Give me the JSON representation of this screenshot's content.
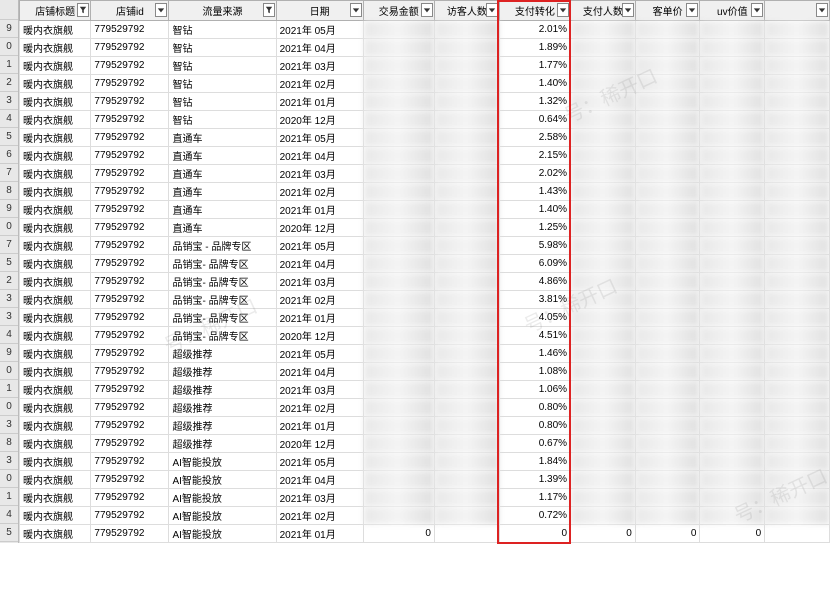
{
  "columns": [
    {
      "key": "shop",
      "label": "店铺标题",
      "filtered": true
    },
    {
      "key": "id",
      "label": "店铺id",
      "filtered": false
    },
    {
      "key": "src",
      "label": "流量来源",
      "filtered": true
    },
    {
      "key": "date",
      "label": "日期",
      "filtered": false
    },
    {
      "key": "amt",
      "label": "交易金额",
      "filtered": false
    },
    {
      "key": "vis",
      "label": "访客人数",
      "filtered": false
    },
    {
      "key": "conv",
      "label": "支付转化",
      "filtered": false
    },
    {
      "key": "pay",
      "label": "支付人数",
      "filtered": false
    },
    {
      "key": "unit",
      "label": "客单价",
      "filtered": false
    },
    {
      "key": "uv",
      "label": "uv价值",
      "filtered": false
    },
    {
      "key": "extra",
      "label": "",
      "filtered": false
    }
  ],
  "rowNumbers": [
    "",
    "9",
    "0",
    "1",
    "2",
    "3",
    "4",
    "5",
    "6",
    "7",
    "8",
    "9",
    "0",
    "7",
    "5",
    "2",
    "3",
    "3",
    "4",
    "9",
    "0",
    "1",
    "0",
    "3",
    "8",
    "3",
    "0",
    "1",
    "4",
    "5"
  ],
  "rows": [
    {
      "shop": "暖内衣旗舰",
      "id": "779529792",
      "src": "智钻",
      "date": "2021年 05月",
      "conv": "2.01%"
    },
    {
      "shop": "暖内衣旗舰",
      "id": "779529792",
      "src": "智钻",
      "date": "2021年 04月",
      "conv": "1.89%"
    },
    {
      "shop": "暖内衣旗舰",
      "id": "779529792",
      "src": "智钻",
      "date": "2021年 03月",
      "conv": "1.77%"
    },
    {
      "shop": "暖内衣旗舰",
      "id": "779529792",
      "src": "智钻",
      "date": "2021年 02月",
      "conv": "1.40%"
    },
    {
      "shop": "暖内衣旗舰",
      "id": "779529792",
      "src": "智钻",
      "date": "2021年 01月",
      "conv": "1.32%"
    },
    {
      "shop": "暖内衣旗舰",
      "id": "779529792",
      "src": "智钻",
      "date": "2020年 12月",
      "conv": "0.64%"
    },
    {
      "shop": "暖内衣旗舰",
      "id": "779529792",
      "src": "直通车",
      "date": "2021年 05月",
      "conv": "2.58%"
    },
    {
      "shop": "暖内衣旗舰",
      "id": "779529792",
      "src": "直通车",
      "date": "2021年 04月",
      "conv": "2.15%"
    },
    {
      "shop": "暖内衣旗舰",
      "id": "779529792",
      "src": "直通车",
      "date": "2021年 03月",
      "conv": "2.02%"
    },
    {
      "shop": "暖内衣旗舰",
      "id": "779529792",
      "src": "直通车",
      "date": "2021年 02月",
      "conv": "1.43%"
    },
    {
      "shop": "暖内衣旗舰",
      "id": "779529792",
      "src": "直通车",
      "date": "2021年 01月",
      "conv": "1.40%"
    },
    {
      "shop": "暖内衣旗舰",
      "id": "779529792",
      "src": "直通车",
      "date": "2020年 12月",
      "conv": "1.25%"
    },
    {
      "shop": "暖内衣旗舰",
      "id": "779529792",
      "src": "品销宝 - 品牌专区",
      "date": "2021年 05月",
      "conv": "5.98%"
    },
    {
      "shop": "暖内衣旗舰",
      "id": "779529792",
      "src": "品销宝- 品牌专区",
      "date": "2021年 04月",
      "conv": "6.09%"
    },
    {
      "shop": "暖内衣旗舰",
      "id": "779529792",
      "src": "品销宝- 品牌专区",
      "date": "2021年 03月",
      "conv": "4.86%"
    },
    {
      "shop": "暖内衣旗舰",
      "id": "779529792",
      "src": "品销宝- 品牌专区",
      "date": "2021年 02月",
      "conv": "3.81%"
    },
    {
      "shop": "暖内衣旗舰",
      "id": "779529792",
      "src": "品销宝- 品牌专区",
      "date": "2021年 01月",
      "conv": "4.05%"
    },
    {
      "shop": "暖内衣旗舰",
      "id": "779529792",
      "src": "品销宝- 品牌专区",
      "date": "2020年 12月",
      "conv": "4.51%"
    },
    {
      "shop": "暖内衣旗舰",
      "id": "779529792",
      "src": "超级推荐",
      "date": "2021年 05月",
      "conv": "1.46%"
    },
    {
      "shop": "暖内衣旗舰",
      "id": "779529792",
      "src": "超级推荐",
      "date": "2021年 04月",
      "conv": "1.08%"
    },
    {
      "shop": "暖内衣旗舰",
      "id": "779529792",
      "src": "超级推荐",
      "date": "2021年 03月",
      "conv": "1.06%"
    },
    {
      "shop": "暖内衣旗舰",
      "id": "779529792",
      "src": "超级推荐",
      "date": "2021年 02月",
      "conv": "0.80%"
    },
    {
      "shop": "暖内衣旗舰",
      "id": "779529792",
      "src": "超级推荐",
      "date": "2021年 01月",
      "conv": "0.80%"
    },
    {
      "shop": "暖内衣旗舰",
      "id": "779529792",
      "src": "超级推荐",
      "date": "2020年 12月",
      "conv": "0.67%"
    },
    {
      "shop": "暖内衣旗舰",
      "id": "779529792",
      "src": "AI智能投放",
      "date": "2021年 05月",
      "conv": "1.84%"
    },
    {
      "shop": "暖内衣旗舰",
      "id": "779529792",
      "src": "AI智能投放",
      "date": "2021年 04月",
      "conv": "1.39%"
    },
    {
      "shop": "暖内衣旗舰",
      "id": "779529792",
      "src": "AI智能投放",
      "date": "2021年 03月",
      "conv": "1.17%"
    },
    {
      "shop": "暖内衣旗舰",
      "id": "779529792",
      "src": "AI智能投放",
      "date": "2021年 02月",
      "conv": "0.72%"
    },
    {
      "shop": "暖内衣旗舰",
      "id": "779529792",
      "src": "AI智能投放",
      "date": "2021年 01月",
      "amt": "0",
      "vis": "",
      "conv": "0",
      "pay": "0",
      "unit": "0",
      "uv": "0"
    }
  ],
  "highlightColumn": "conv",
  "watermark": "号：稀开口"
}
